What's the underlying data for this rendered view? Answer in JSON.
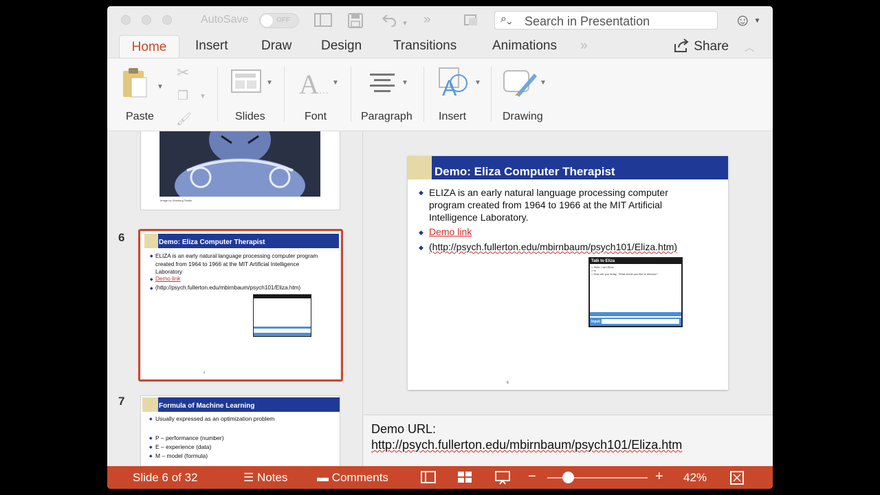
{
  "titlebar": {
    "autosave_label": "AutoSave",
    "autosave_state": "OFF",
    "search_placeholder": "Search in Presentation"
  },
  "tabs": [
    {
      "label": "Home",
      "active": true
    },
    {
      "label": "Insert"
    },
    {
      "label": "Draw"
    },
    {
      "label": "Design"
    },
    {
      "label": "Transitions"
    },
    {
      "label": "Animations"
    }
  ],
  "share_label": "Share",
  "ribbon": {
    "paste": "Paste",
    "slides": "Slides",
    "font": "Font",
    "paragraph": "Paragraph",
    "insert": "Insert",
    "drawing": "Drawing"
  },
  "thumbnails": {
    "prev_caption": "Image by Ginsburg Studio",
    "slide6": {
      "number": "6",
      "title": "Demo: Eliza Computer Therapist",
      "b1": "ELIZA is an early natural language processing computer program created from 1964 to 1966 at the MIT Artificial Intelligence Laboratory",
      "b2": "Demo link",
      "b3": "(http://psych.fullerton.edu/mbirnbaum/psych101/Eliza.htm)",
      "footer": "6"
    },
    "slide7": {
      "number": "7",
      "title": "Formula of Machine Learning",
      "b1": "Usually expressed as an optimization problem",
      "b2": "P – performance (number)",
      "b3": "E – experience (data)",
      "b4": "M – model (formula)"
    }
  },
  "slide": {
    "title": "Demo: Eliza Computer Therapist",
    "b1_line1": "ELIZA is an early natural language processing computer",
    "b1_line2": "program created from 1964 to 1966 at the MIT Artificial",
    "b1_line3": "Intelligence Laboratory.",
    "b2": "Demo link",
    "b3": "(http://psych.fullerton.edu/mbirnbaum/psych101/Eliza.htm)",
    "mini_title": "Talk to Eliza",
    "mini_l1": "> Hello, I am Eliza.",
    "mini_l2": "> hi",
    "mini_l3": "> How are you today.. What would you like to discuss?",
    "mini_input": "Input:",
    "page_number": "6"
  },
  "notes": {
    "line1": "Demo URL:",
    "line2": "http://psych.fullerton.edu/mbirnbaum/psych101/Eliza.htm"
  },
  "status": {
    "slide_position": "Slide 6 of 32",
    "notes": "Notes",
    "comments": "Comments",
    "zoom": "42%",
    "zoom_fraction": 0.42
  },
  "colors": {
    "accent": "#c9482b",
    "slide_header": "#1f3996",
    "slide_accent": "#e6d9a7",
    "link": "#d32b2b"
  }
}
